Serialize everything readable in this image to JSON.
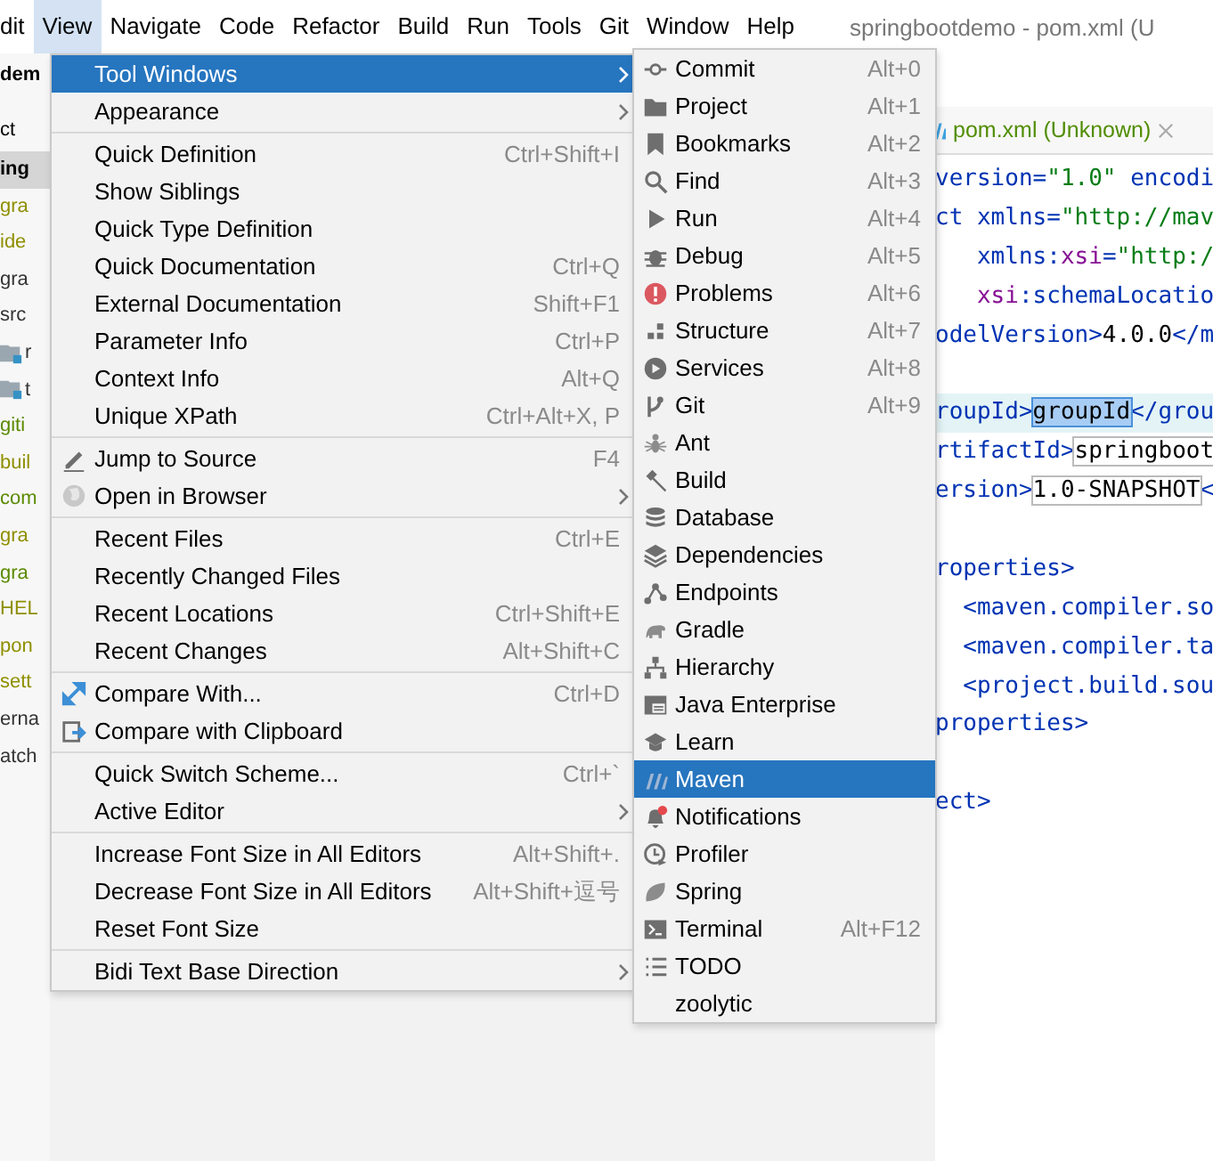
{
  "menubar": {
    "items": [
      {
        "label": "dit",
        "selected": false
      },
      {
        "label": "View",
        "selected": true
      },
      {
        "label": "Navigate",
        "selected": false
      },
      {
        "label": "Code",
        "selected": false
      },
      {
        "label": "Refactor",
        "selected": false
      },
      {
        "label": "Build",
        "selected": false
      },
      {
        "label": "Run",
        "selected": false
      },
      {
        "label": "Tools",
        "selected": false
      },
      {
        "label": "Git",
        "selected": false
      },
      {
        "label": "Window",
        "selected": false
      },
      {
        "label": "Help",
        "selected": false
      }
    ],
    "title": "springbootdemo - pom.xml (U"
  },
  "project_panel": {
    "header": "dem",
    "tab": "ct",
    "rows": [
      {
        "text": "ing",
        "kind": "text",
        "selected": true
      },
      {
        "text": "gra",
        "kind": "text",
        "selected": false,
        "color": "#8f8f00"
      },
      {
        "text": "ide",
        "kind": "text",
        "selected": false,
        "color": "#8f8f00"
      },
      {
        "text": "gra",
        "kind": "text",
        "selected": false,
        "color": "#333333"
      },
      {
        "text": "src",
        "kind": "text",
        "selected": false,
        "color": "#333333"
      },
      {
        "text": "r",
        "kind": "folder",
        "selected": false,
        "color": "#333333"
      },
      {
        "text": "t",
        "kind": "folder",
        "selected": false,
        "color": "#333333"
      },
      {
        "text": "giti",
        "kind": "text",
        "selected": false,
        "color": "#5a8a00"
      },
      {
        "text": "buil",
        "kind": "text",
        "selected": false,
        "color": "#8f8f00"
      },
      {
        "text": "com",
        "kind": "text",
        "selected": false,
        "color": "#5a8a00"
      },
      {
        "text": "gra",
        "kind": "text",
        "selected": false,
        "color": "#8f8f00"
      },
      {
        "text": "gra",
        "kind": "text",
        "selected": false,
        "color": "#5a8a00"
      },
      {
        "text": "HEL",
        "kind": "text",
        "selected": false,
        "color": "#8f8f00"
      },
      {
        "text": "pon",
        "kind": "text",
        "selected": false,
        "color": "#8f8f00"
      },
      {
        "text": "sett",
        "kind": "text",
        "selected": false,
        "color": "#8f8f00"
      },
      {
        "text": "erna",
        "kind": "text",
        "selected": false,
        "color": "#333333"
      },
      {
        "text": "atch",
        "kind": "text",
        "selected": false,
        "color": "#333333"
      }
    ]
  },
  "main_menu": {
    "sections": [
      [
        {
          "label": "Tool Windows",
          "submenu": true,
          "selected": true
        },
        {
          "label": "Appearance",
          "submenu": true,
          "selected": false
        }
      ],
      [
        {
          "label": "Quick Definition",
          "shortcut": "Ctrl+Shift+I",
          "submenu": false,
          "selected": false
        },
        {
          "label": "Show Siblings",
          "submenu": false,
          "selected": false
        },
        {
          "label": "Quick Type Definition",
          "submenu": false,
          "selected": false
        },
        {
          "label": "Quick Documentation",
          "shortcut": "Ctrl+Q",
          "submenu": false,
          "selected": false
        },
        {
          "label": "External Documentation",
          "shortcut": "Shift+F1",
          "submenu": false,
          "selected": false
        },
        {
          "label": "Parameter Info",
          "shortcut": "Ctrl+P",
          "submenu": false,
          "selected": false
        },
        {
          "label": "Context Info",
          "shortcut": "Alt+Q",
          "submenu": false,
          "selected": false
        },
        {
          "label": "Unique XPath",
          "shortcut": "Ctrl+Alt+X, P",
          "submenu": false,
          "selected": false
        }
      ],
      [
        {
          "label": "Jump to Source",
          "shortcut": "F4",
          "submenu": false,
          "selected": false
        },
        {
          "label": "Open in Browser",
          "submenu": true,
          "selected": false
        }
      ],
      [
        {
          "label": "Recent Files",
          "shortcut": "Ctrl+E",
          "submenu": false,
          "selected": false
        },
        {
          "label": "Recently Changed Files",
          "submenu": false,
          "selected": false
        },
        {
          "label": "Recent Locations",
          "shortcut": "Ctrl+Shift+E",
          "submenu": false,
          "selected": false
        },
        {
          "label": "Recent Changes",
          "shortcut": "Alt+Shift+C",
          "submenu": false,
          "selected": false
        }
      ],
      [
        {
          "label": "Compare With...",
          "shortcut": "Ctrl+D",
          "submenu": false,
          "selected": false
        },
        {
          "label": "Compare with Clipboard",
          "submenu": false,
          "selected": false
        }
      ],
      [
        {
          "label": "Quick Switch Scheme...",
          "shortcut": "Ctrl+`",
          "submenu": false,
          "selected": false
        },
        {
          "label": "Active Editor",
          "submenu": true,
          "selected": false
        }
      ],
      [
        {
          "label": "Increase Font Size in All Editors",
          "shortcut": "Alt+Shift+.",
          "submenu": false,
          "selected": false
        },
        {
          "label": "Decrease Font Size in All Editors",
          "shortcut": "Alt+Shift+逗号",
          "submenu": false,
          "selected": false
        },
        {
          "label": "Reset Font Size",
          "submenu": false,
          "selected": false
        }
      ],
      [
        {
          "label": "Bidi Text Base Direction",
          "submenu": true,
          "selected": false
        }
      ]
    ]
  },
  "tool_windows_submenu": {
    "items": [
      {
        "label": "Commit",
        "shortcut": "Alt+0",
        "selected": false
      },
      {
        "label": "Project",
        "shortcut": "Alt+1",
        "selected": false
      },
      {
        "label": "Bookmarks",
        "shortcut": "Alt+2",
        "selected": false
      },
      {
        "label": "Find",
        "shortcut": "Alt+3",
        "selected": false
      },
      {
        "label": "Run",
        "shortcut": "Alt+4",
        "selected": false
      },
      {
        "label": "Debug",
        "shortcut": "Alt+5",
        "selected": false
      },
      {
        "label": "Problems",
        "shortcut": "Alt+6",
        "selected": false
      },
      {
        "label": "Structure",
        "shortcut": "Alt+7",
        "selected": false
      },
      {
        "label": "Services",
        "shortcut": "Alt+8",
        "selected": false
      },
      {
        "label": "Git",
        "shortcut": "Alt+9",
        "selected": false
      },
      {
        "label": "Ant",
        "selected": false
      },
      {
        "label": "Build",
        "selected": false
      },
      {
        "label": "Database",
        "selected": false
      },
      {
        "label": "Dependencies",
        "selected": false
      },
      {
        "label": "Endpoints",
        "selected": false
      },
      {
        "label": "Gradle",
        "selected": false
      },
      {
        "label": "Hierarchy",
        "selected": false
      },
      {
        "label": "Java Enterprise",
        "selected": false
      },
      {
        "label": "Learn",
        "selected": false
      },
      {
        "label": "Maven",
        "selected": true
      },
      {
        "label": "Notifications",
        "selected": false
      },
      {
        "label": "Profiler",
        "selected": false
      },
      {
        "label": "Spring",
        "selected": false
      },
      {
        "label": "Terminal",
        "shortcut": "Alt+F12",
        "selected": false
      },
      {
        "label": "TODO",
        "selected": false
      },
      {
        "label": "zoolytic",
        "selected": false
      }
    ]
  },
  "editor": {
    "tab": {
      "title": "pom.xml (Unknown)"
    },
    "lines": [
      {
        "current": false,
        "segments": [
          {
            "text": "version=",
            "kind": "attr"
          },
          {
            "text": "\"1.0\"",
            "kind": "value"
          },
          {
            "text": " encodi",
            "kind": "attr"
          }
        ]
      },
      {
        "current": false,
        "segments": [
          {
            "text": "ct ",
            "kind": "tag"
          },
          {
            "text": "xmlns=",
            "kind": "attr"
          },
          {
            "text": "\"http://mav",
            "kind": "value"
          }
        ]
      },
      {
        "current": false,
        "segments": [
          {
            "text": "   xmlns:",
            "kind": "attr"
          },
          {
            "text": "xsi",
            "kind": "ns"
          },
          {
            "text": "=",
            "kind": "attr"
          },
          {
            "text": "\"http:/",
            "kind": "value"
          }
        ]
      },
      {
        "current": false,
        "segments": [
          {
            "text": "   xsi",
            "kind": "ns"
          },
          {
            "text": ":schemaLocatio",
            "kind": "attr"
          }
        ]
      },
      {
        "current": false,
        "segments": [
          {
            "text": "odelVersion>",
            "kind": "tag"
          },
          {
            "text": "4.0.0",
            "kind": "text"
          },
          {
            "text": "</m",
            "kind": "tag"
          }
        ]
      },
      {
        "current": false
      },
      {
        "current": true,
        "segments": [
          {
            "text": "roupId>",
            "kind": "tag"
          },
          {
            "text": "groupId",
            "kind": "selection"
          },
          {
            "text": "</grou",
            "kind": "tag"
          }
        ]
      },
      {
        "current": false,
        "segments": [
          {
            "text": "rtifactId>",
            "kind": "tag"
          },
          {
            "text": "springboot",
            "kind": "boxed"
          }
        ]
      },
      {
        "current": false,
        "segments": [
          {
            "text": "ersion>",
            "kind": "tag"
          },
          {
            "text": "1.0-SNAPSHOT",
            "kind": "boxed"
          },
          {
            "text": "<",
            "kind": "tag"
          }
        ]
      },
      {
        "current": false
      },
      {
        "current": false,
        "segments": [
          {
            "text": "roperties>",
            "kind": "tag"
          }
        ]
      },
      {
        "current": false,
        "segments": [
          {
            "text": "  <maven.compiler.so",
            "kind": "tag"
          }
        ]
      },
      {
        "current": false,
        "segments": [
          {
            "text": "  <maven.compiler.ta",
            "kind": "tag"
          }
        ]
      },
      {
        "current": false,
        "segments": [
          {
            "text": "  <project.build.sou",
            "kind": "tag"
          }
        ]
      },
      {
        "current": false,
        "segments": [
          {
            "text": "properties>",
            "kind": "tag"
          }
        ]
      },
      {
        "current": false
      },
      {
        "current": false,
        "segments": [
          {
            "text": "ect>",
            "kind": "tag"
          }
        ]
      }
    ]
  }
}
